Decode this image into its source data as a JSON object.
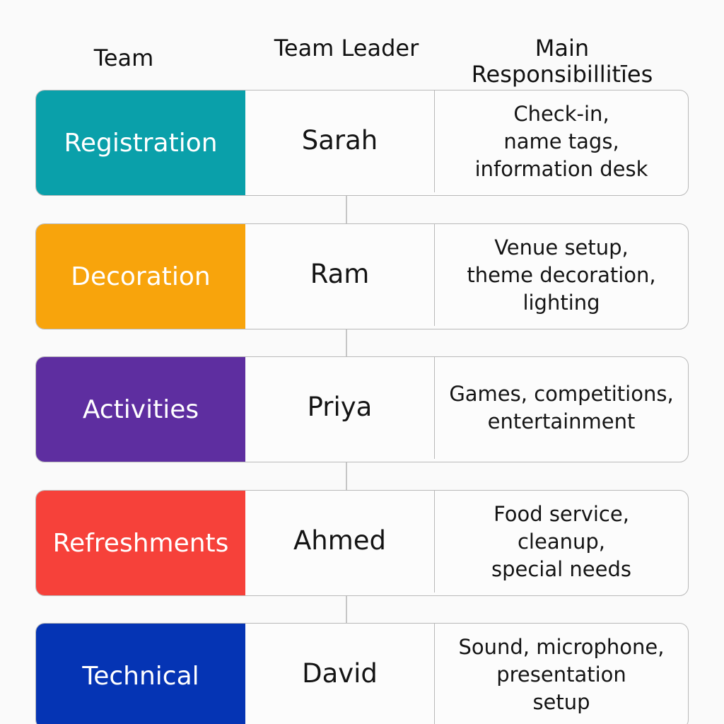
{
  "headers": {
    "team": "Team",
    "leader": "Team Leader",
    "responsibilities_line1": "Main",
    "responsibilities_line2": "Responsibillitīes"
  },
  "teams": [
    {
      "name": "Registration",
      "color": "#0aa0aa",
      "leader": "Sarah",
      "responsibilities": [
        "Check-in,",
        "name tags,",
        "information desk"
      ]
    },
    {
      "name": "Decoration",
      "color": "#f8a40c",
      "leader": "Ram",
      "responsibilities": [
        "Venue setup,",
        "theme decoration,",
        "lighting"
      ]
    },
    {
      "name": "Activities",
      "color": "#5e2ea0",
      "leader": "Priya",
      "responsibilities": [
        "Games, competitions,",
        "entertainment"
      ]
    },
    {
      "name": "Refreshments",
      "color": "#f6413a",
      "leader": "Ahmed",
      "responsibilities": [
        "Food service,",
        "cleanup,",
        "special needs"
      ]
    },
    {
      "name": "Technical",
      "color": "#0534b4",
      "leader": "David",
      "responsibilities": [
        "Sound, microphone,",
        "presentation",
        "setup"
      ]
    }
  ]
}
